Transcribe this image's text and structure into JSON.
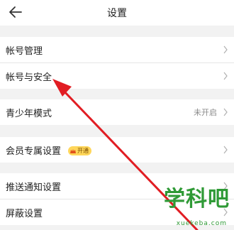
{
  "header": {
    "title": "设置",
    "back_icon": "back-arrow-icon"
  },
  "settings": [
    {
      "label": "帐号管理"
    },
    {
      "label": "帐号与安全"
    },
    {
      "label": "青少年模式",
      "value": "未开启"
    },
    {
      "label": "会员专属设置",
      "badge": "开通"
    },
    {
      "label": "推送通知设置"
    },
    {
      "label": "屏蔽设置"
    }
  ],
  "watermark": {
    "text": "学科吧",
    "url": "xuekeba.com"
  },
  "colors": {
    "annotation_arrow": "#e11d23",
    "watermark": "#2f9a36"
  }
}
